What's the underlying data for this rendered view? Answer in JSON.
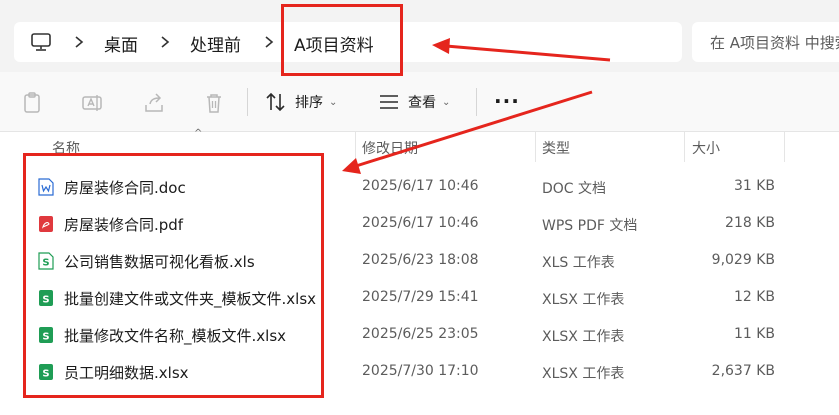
{
  "address": {
    "crumbs": [
      "桌面",
      "处理前",
      "A项目资料"
    ],
    "search_placeholder": "在 A项目资料 中搜索"
  },
  "toolbar": {
    "sort_label": "排序",
    "view_label": "查看"
  },
  "columns": {
    "name": "名称",
    "date": "修改日期",
    "type": "类型",
    "size": "大小"
  },
  "files": [
    {
      "name": "房屋装修合同.doc",
      "date": "2025/6/17 10:46",
      "type": "DOC 文档",
      "size": "31 KB",
      "icon": "word-doc-icon"
    },
    {
      "name": "房屋装修合同.pdf",
      "date": "2025/6/17 10:46",
      "type": "WPS PDF 文档",
      "size": "218 KB",
      "icon": "pdf-icon"
    },
    {
      "name": "公司销售数据可视化看板.xls",
      "date": "2025/6/23 18:08",
      "type": "XLS 工作表",
      "size": "9,029 KB",
      "icon": "xls-icon"
    },
    {
      "name": "批量创建文件或文件夹_模板文件.xlsx",
      "date": "2025/7/29 15:41",
      "type": "XLSX 工作表",
      "size": "12 KB",
      "icon": "xlsx-icon"
    },
    {
      "name": "批量修改文件名称_模板文件.xlsx",
      "date": "2025/6/25 23:05",
      "type": "XLSX 工作表",
      "size": "11 KB",
      "icon": "xlsx-icon"
    },
    {
      "name": "员工明细数据.xlsx",
      "date": "2025/7/30 17:10",
      "type": "XLSX 工作表",
      "size": "2,637 KB",
      "icon": "xlsx-icon"
    }
  ],
  "colors": {
    "annotation": "#e5251d",
    "word": "#2b6cd4",
    "pdf": "#e0393e",
    "excel": "#1f9d55"
  }
}
